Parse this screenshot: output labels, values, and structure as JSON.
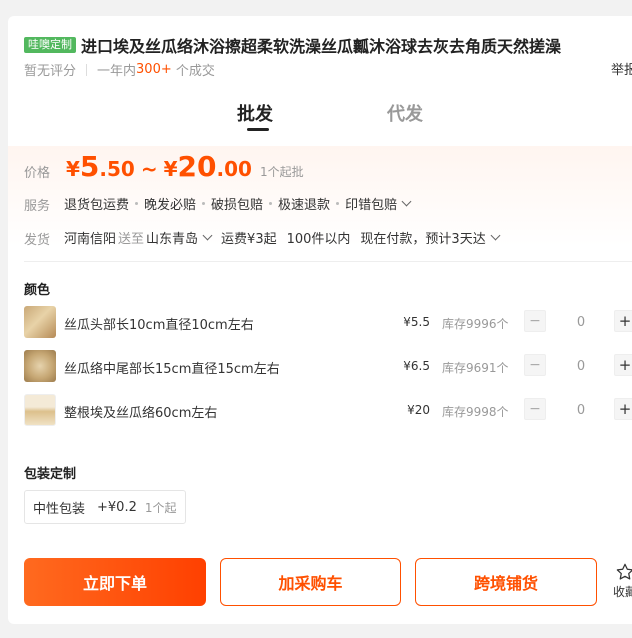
{
  "product": {
    "tag": "哇噢定制",
    "title": "进口埃及丝瓜络沐浴擦超柔软洗澡丝瓜瓤沐浴球去灰去角质天然搓澡",
    "rating": "暂无评分",
    "sales_prefix": "一年内",
    "sales_count": "300+",
    "sales_suffix": " 个成交",
    "report": "举报"
  },
  "tabs": [
    {
      "label": "批发",
      "active": true
    },
    {
      "label": "代发",
      "active": false
    }
  ],
  "price": {
    "label": "价格",
    "currency": "¥",
    "min_int": "5",
    "min_dec": ".50",
    "tilde": "~",
    "max_int": "20",
    "max_dec": ".00",
    "moq": "1个起批"
  },
  "service": {
    "label": "服务",
    "items": [
      "退货包运费",
      "晚发必赔",
      "破损包赔",
      "极速退款",
      "印错包赔"
    ]
  },
  "shipping": {
    "label": "发货",
    "from": "河南信阳",
    "to_word": "送至",
    "to": "山东青岛",
    "fee": "运费¥3起",
    "range": "100件以内",
    "eta": "现在付款，预计3天达"
  },
  "color": {
    "label": "颜色",
    "skus": [
      {
        "name": "丝瓜头部长10cm直径10cm左右",
        "price": "¥5.5",
        "stock": "库存9996个",
        "qty": "0"
      },
      {
        "name": "丝瓜络中尾部长15cm直径15cm左右",
        "price": "¥6.5",
        "stock": "库存9691个",
        "qty": "0"
      },
      {
        "name": "整根埃及丝瓜络60cm左右",
        "price": "¥20",
        "stock": "库存9998个",
        "qty": "0"
      }
    ],
    "minus": "−",
    "plus": "+"
  },
  "packaging": {
    "label": "包装定制",
    "option": "中性包装",
    "price": "+¥0.2",
    "moq": "1个起"
  },
  "actions": {
    "buy": "立即下单",
    "cart": "加采购车",
    "crossborder": "跨境铺货",
    "favorite": "收藏"
  },
  "colors": {
    "accent": "#ff5000",
    "tag_green": "#52b85e"
  },
  "icons": {
    "favorite": "star-outline-icon",
    "dropdown": "chevron-down-icon"
  }
}
